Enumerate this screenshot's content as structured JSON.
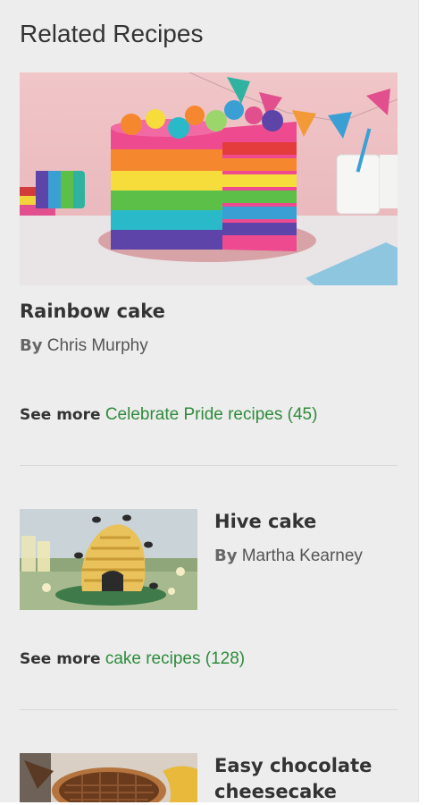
{
  "section_title": "Related Recipes",
  "recipes": [
    {
      "title": "Rainbow cake",
      "by_label": "By",
      "author": "Chris Murphy",
      "see_more_label": "See more",
      "see_more_link": "Celebrate Pride recipes (45)"
    },
    {
      "title": "Hive cake",
      "by_label": "By",
      "author": "Martha Kearney",
      "see_more_label": "See more",
      "see_more_link": "cake recipes (128)"
    },
    {
      "title": "Easy chocolate cheesecake"
    }
  ],
  "colors": {
    "link": "#2e8b3c",
    "text": "#333333",
    "panel": "#ededed"
  }
}
